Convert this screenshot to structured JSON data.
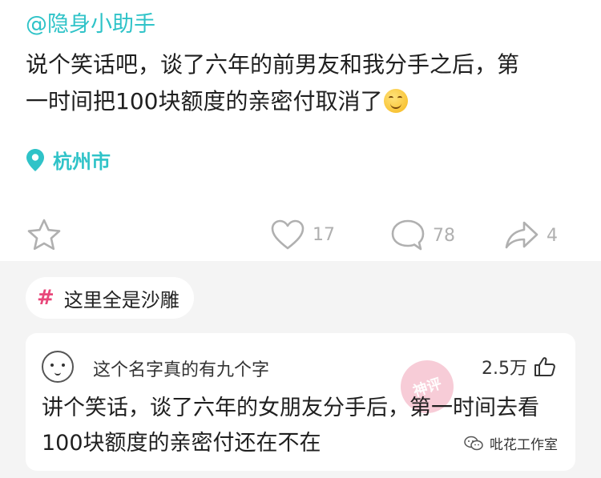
{
  "post": {
    "mention": "@隐身小助手",
    "line1": "说个笑话吧，谈了六年的前男友和我分手之后，第",
    "line2": "一时间把100块额度的亲密付取消了",
    "emoji": "smile-emoji",
    "location": "杭州市"
  },
  "actions": {
    "likes": "17",
    "comments": "78",
    "shares": "4"
  },
  "topic": {
    "hash": "#",
    "label": "这里全是沙雕"
  },
  "comment": {
    "username": "这个名字真的有九个字",
    "likes": "2.5万",
    "line1": "讲个笑话，谈了六年的女朋友分手后，第一时间去看",
    "line2": "100块额度的亲密付还在不在",
    "stamp": "神评"
  },
  "watermark": {
    "text": "吡花工作室"
  },
  "colors": {
    "accent": "#2fc3c8",
    "topic_hash": "#e8477a",
    "icon_gray": "#b0b0b0"
  }
}
